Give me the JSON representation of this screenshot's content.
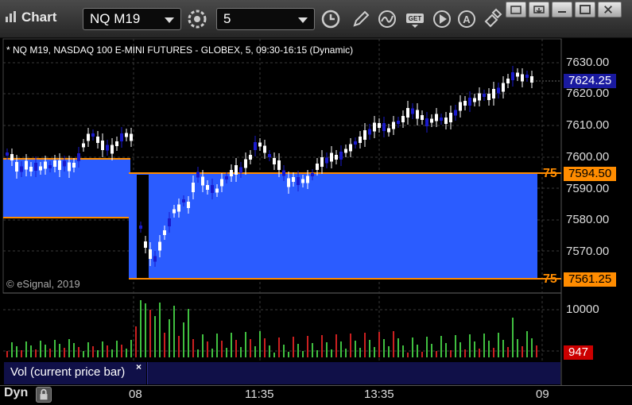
{
  "toolbar": {
    "title": "Chart",
    "symbol": "NQ M19",
    "interval": "5",
    "icons": [
      "settings-gear-icon",
      "clock-icon",
      "pencil-draw-icon",
      "study-curve-icon",
      "get-data-icon",
      "play-icon",
      "alert-icon",
      "link-icon"
    ]
  },
  "window_controls": [
    "restore-icon",
    "pin-icon",
    "maximize-icon",
    "close-icon"
  ],
  "chart": {
    "header": "* NQ M19, NASDAQ 100 E-MINI FUTURES - GLOBEX, 5, 09:30-16:15 (Dynamic)",
    "copyright": "© eSignal, 2019",
    "price_axis_labels": [
      "7630.00",
      "7620.00",
      "7610.00",
      "7600.00",
      "7590.00",
      "7580.00",
      "7570.00"
    ],
    "last_price": "7624.25",
    "range_high": "7594.50",
    "range_low": "7561.25",
    "range_tag_high": "75",
    "range_tag_low": "75",
    "colors": {
      "range_fill": "#2b5cff",
      "range_line": "#ff8c00",
      "up_bar": "#ffffff",
      "down_bar": "#1a1acc",
      "vol_up": "#40c040",
      "vol_down": "#cc2020"
    }
  },
  "volume": {
    "panel_label": "Vol (current price bar)",
    "close_glyph": "×",
    "axis_label": "10000",
    "current_value": "947"
  },
  "time_axis": {
    "labels": [
      "08",
      "11:35",
      "13:35",
      "09"
    ],
    "mode": "Dyn"
  }
}
